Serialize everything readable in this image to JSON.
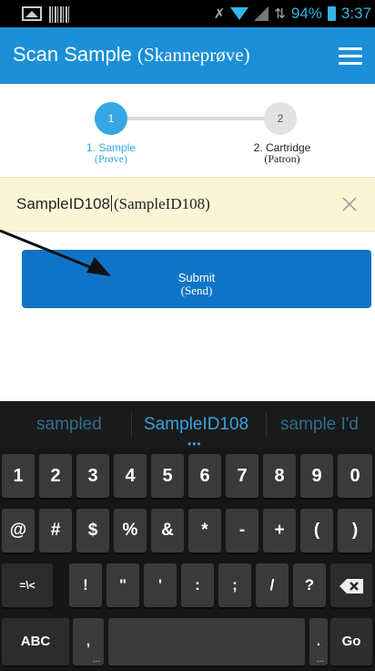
{
  "status_bar": {
    "battery": "94%",
    "time": "3:37"
  },
  "app_bar": {
    "title": "Scan Sample",
    "title_translation": "(Skanneprøve)"
  },
  "stepper": {
    "steps": [
      {
        "number": "1",
        "label": "1. Sample",
        "translation": "(Prøve)",
        "active": true
      },
      {
        "number": "2",
        "label": "2. Cartridge",
        "translation": "(Patron)",
        "active": false
      }
    ]
  },
  "sample_input": {
    "value": "SampleID108",
    "translation": "(SampleID108)"
  },
  "submit_button": {
    "label": "Submit",
    "translation": "(Send)"
  },
  "keyboard": {
    "suggestions": [
      "sampled",
      "SampleID108",
      "sample I'd"
    ],
    "row1": [
      "1",
      "2",
      "3",
      "4",
      "5",
      "6",
      "7",
      "8",
      "9",
      "0"
    ],
    "row2": [
      "@",
      "#",
      "$",
      "%",
      "&",
      "*",
      "-",
      "+",
      "(",
      ")"
    ],
    "row3": [
      "=\\<",
      "!",
      "\"",
      "'",
      ":",
      ";",
      "/",
      "?"
    ],
    "row4": {
      "abc": "ABC",
      "comma": ",",
      "period": ".",
      "go": "Go"
    }
  },
  "colors": {
    "app_bar": "#1b8fd8",
    "accent": "#35a7e3",
    "submit": "#0f74c7",
    "input_bg": "#fbf5d8"
  }
}
